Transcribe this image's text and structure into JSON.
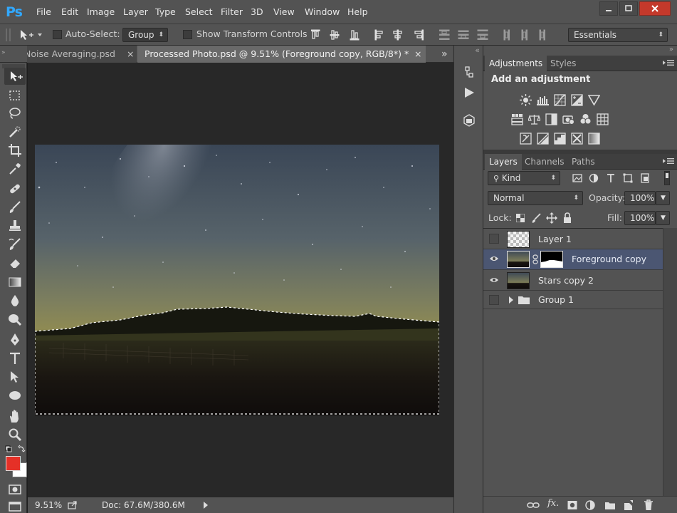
{
  "app": {
    "logo": "Ps",
    "menu": [
      "File",
      "Edit",
      "Image",
      "Layer",
      "Type",
      "Select",
      "Filter",
      "3D",
      "View",
      "Window",
      "Help"
    ],
    "window_controls": {
      "minimize": "▁",
      "maximize": "▢",
      "close": "✕"
    }
  },
  "options": {
    "auto_select_label": "Auto-Select:",
    "auto_select_value": "Group",
    "show_transform_label": "Show Transform Controls",
    "workspace": "Essentials"
  },
  "tabs": [
    {
      "label": "Noise Averaging.psd",
      "active": false,
      "close": "×"
    },
    {
      "label": "Processed Photo.psd @ 9.51% (Foreground copy, RGB/8*) *",
      "active": true,
      "close": "×"
    }
  ],
  "tabs_overflow": "»",
  "status": {
    "zoom": "9.51%",
    "doc": "Doc: 67.6M/380.6M"
  },
  "colors": {
    "foreground": "#e53027",
    "background": "#ffffff",
    "accent": "#31a8ff",
    "selected_layer": "#4b5672"
  },
  "adjustments": {
    "tabs": [
      "Adjustments",
      "Styles"
    ],
    "heading": "Add an adjustment",
    "icons_row1": [
      "brightness-contrast-icon",
      "levels-icon",
      "curves-icon",
      "exposure-icon",
      "vibrance-icon"
    ],
    "icons_row2": [
      "hue-saturation-icon",
      "color-balance-icon",
      "black-white-icon",
      "photo-filter-icon",
      "channel-mixer-icon",
      "color-lookup-icon"
    ],
    "icons_row3": [
      "invert-icon",
      "posterize-icon",
      "threshold-icon",
      "selective-color-icon",
      "gradient-map-icon"
    ]
  },
  "layers_panel": {
    "tabs": [
      "Layers",
      "Channels",
      "Paths"
    ],
    "filter_label": "Kind",
    "blend_mode": "Normal",
    "opacity_label": "Opacity:",
    "opacity_value": "100%",
    "lock_label": "Lock:",
    "fill_label": "Fill:",
    "fill_value": "100%",
    "layers": [
      {
        "name": "Layer 1",
        "visible": false,
        "selected": false
      },
      {
        "name": "Foreground copy",
        "visible": true,
        "selected": true,
        "has_mask": true
      },
      {
        "name": "Stars copy 2",
        "visible": true,
        "selected": false
      },
      {
        "name": "Group 1",
        "visible": false,
        "selected": false,
        "is_group": true
      }
    ]
  }
}
